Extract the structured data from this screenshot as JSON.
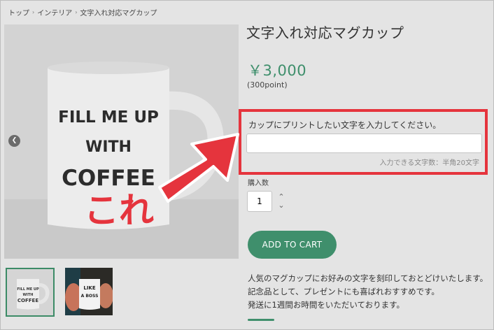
{
  "breadcrumb": {
    "items": [
      "トップ",
      "インテリア",
      "文字入れ対応マグカップ"
    ],
    "separator": "›"
  },
  "product": {
    "title": "文字入れ対応マグカップ",
    "price": "￥3,000",
    "points": "(300point)",
    "mug_text_line1": "FILL ME UP",
    "mug_text_line2": "WITH",
    "mug_text_line3": "COFFEE",
    "thumb2_text_line1": "LIKE",
    "thumb2_text_line2": "A BOSS"
  },
  "custom_text": {
    "label": "カップにプリントしたい文字を入力してください。",
    "value": "",
    "placeholder": "",
    "limit_note": "入力できる文字数：半角20文字"
  },
  "quantity": {
    "label": "購入数",
    "value": "1"
  },
  "cart": {
    "button_label": "ADD TO CART"
  },
  "description": {
    "lines": [
      "人気のマグカップにお好みの文字を刻印しておとどけいたします。",
      "記念品として、プレゼントにも喜ばれおすすめです。",
      "発送に1週間お時間をいただいております。"
    ]
  },
  "annotation": {
    "callout_text": "これ"
  },
  "icons": {
    "carousel_left": "chevron-left-icon",
    "carousel_right": "chevron-right-icon",
    "stepper_up": "chevron-up-icon",
    "stepper_down": "chevron-down-icon",
    "annotation_arrow": "arrow-icon"
  },
  "colors": {
    "accent": "#3f8f6c",
    "annotation": "#e5343d",
    "background": "#e4e4e4"
  }
}
